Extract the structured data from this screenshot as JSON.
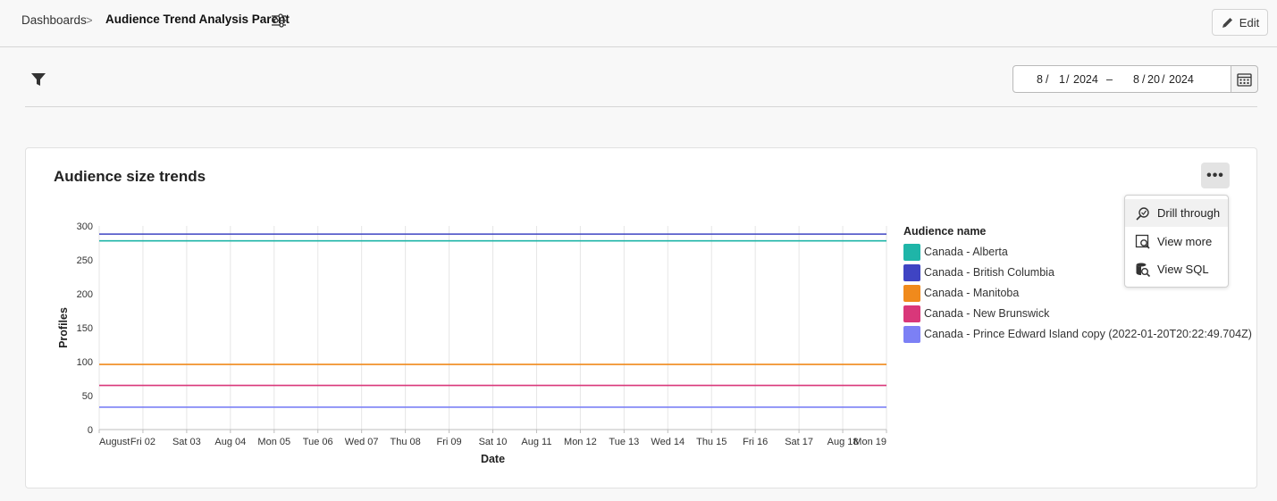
{
  "header": {
    "breadcrumb_root": "Dashboards",
    "breadcrumb_separator": ">",
    "title": "Audience Trend Analysis Parent",
    "edit_label": "Edit"
  },
  "filters": {
    "date_start": {
      "month": "8",
      "day": "1",
      "year": "2024"
    },
    "date_end": {
      "month": "8",
      "day": "20",
      "year": "2024"
    },
    "range_separator": "–"
  },
  "card": {
    "title": "Audience size trends",
    "more_label": "•••",
    "menu": [
      {
        "label": "Drill through",
        "icon": "drill-through-icon"
      },
      {
        "label": "View more",
        "icon": "view-more-icon"
      },
      {
        "label": "View SQL",
        "icon": "view-sql-icon"
      }
    ]
  },
  "chart_data": {
    "type": "line",
    "xlabel": "Date",
    "ylabel": "Profiles",
    "ylim": [
      0,
      300
    ],
    "yticks": [
      0,
      50,
      100,
      150,
      200,
      250,
      300
    ],
    "x": [
      "August",
      "Fri 02",
      "Sat 03",
      "Aug 04",
      "Mon 05",
      "Tue 06",
      "Wed 07",
      "Thu 08",
      "Fri 09",
      "Sat 10",
      "Aug 11",
      "Mon 12",
      "Tue 13",
      "Wed 14",
      "Thu 15",
      "Fri 16",
      "Sat 17",
      "Aug 18",
      "Mon 19"
    ],
    "grid": "vertical",
    "legend_title": "Audience name",
    "legend_position": "right",
    "series": [
      {
        "name": "Canada - Alberta",
        "color": "#1fb5a8",
        "values": [
          278,
          278,
          278,
          278,
          278,
          278,
          278,
          278,
          278,
          278,
          278,
          278,
          278,
          278,
          278,
          278,
          278,
          278,
          278
        ]
      },
      {
        "name": "Canada - British Columbia",
        "color": "#3f44c3",
        "values": [
          288,
          288,
          288,
          288,
          288,
          288,
          288,
          288,
          288,
          288,
          288,
          288,
          288,
          288,
          288,
          288,
          288,
          288,
          288
        ]
      },
      {
        "name": "Canada - Manitoba",
        "color": "#f08a1c",
        "values": [
          96,
          96,
          96,
          96,
          96,
          96,
          96,
          96,
          96,
          96,
          96,
          96,
          96,
          96,
          96,
          96,
          96,
          96,
          96
        ]
      },
      {
        "name": "Canada - New Brunswick",
        "color": "#d9377a",
        "values": [
          65,
          65,
          65,
          65,
          65,
          65,
          65,
          65,
          65,
          65,
          65,
          65,
          65,
          65,
          65,
          65,
          65,
          65,
          65
        ]
      },
      {
        "name": "Canada - Prince Edward Island copy (2022-01-20T20:22:49.704Z)",
        "color": "#7c80f5",
        "values": [
          33,
          33,
          33,
          33,
          33,
          33,
          33,
          33,
          33,
          33,
          33,
          33,
          33,
          33,
          33,
          33,
          33,
          33,
          33
        ]
      }
    ]
  }
}
